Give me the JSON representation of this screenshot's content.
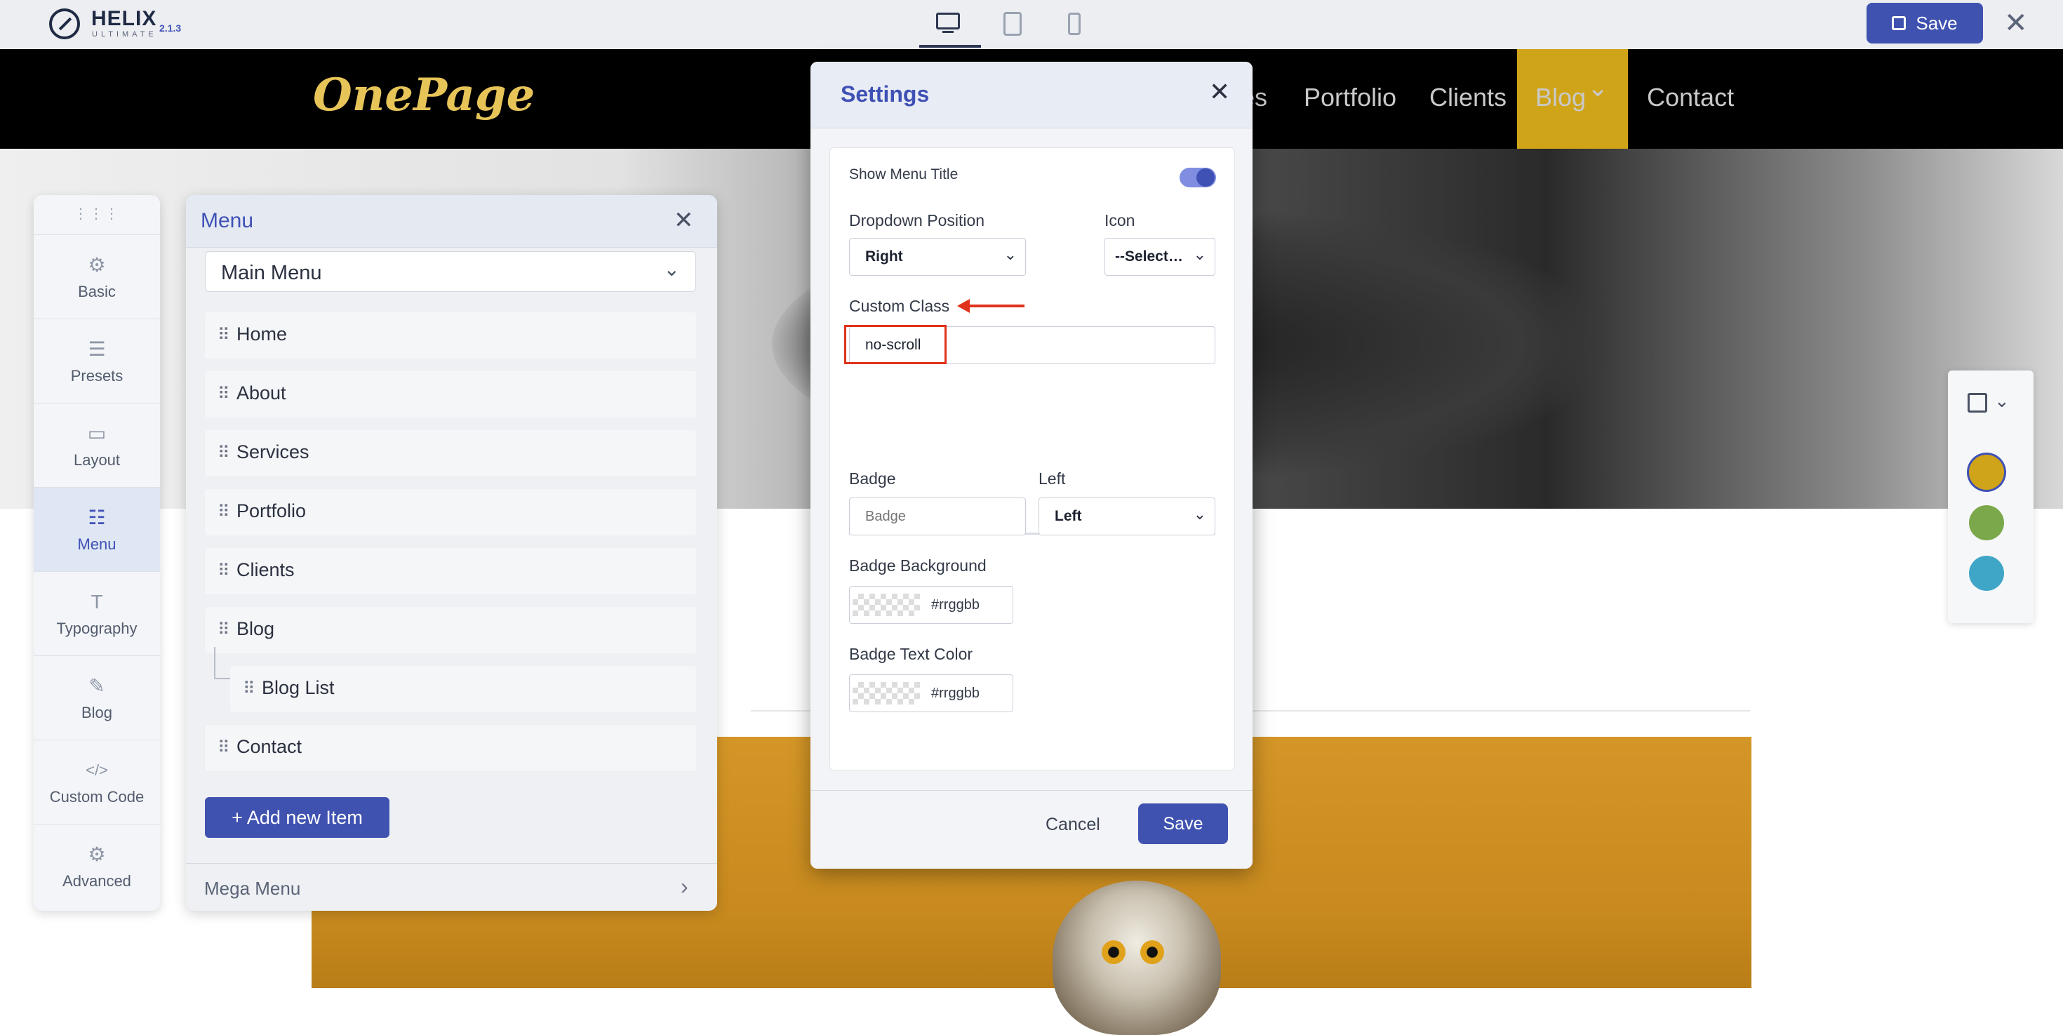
{
  "app": {
    "brand_name": "HELIX",
    "brand_sub": "ULTIMATE",
    "version": "2.1.3",
    "save_label": "Save",
    "close_symbol": "✕"
  },
  "site": {
    "logo_text": "OnePage",
    "nav": [
      "es",
      "Portfolio",
      "Clients",
      "Blog",
      "Contact"
    ],
    "blog_chevron": "⌄"
  },
  "sidebar": {
    "handle": "⋮⋮⋮",
    "items": [
      {
        "label": "Basic",
        "icon": "⚙"
      },
      {
        "label": "Presets",
        "icon": "☰"
      },
      {
        "label": "Layout",
        "icon": "▭"
      },
      {
        "label": "Menu",
        "icon": "☷"
      },
      {
        "label": "Typography",
        "icon": "T"
      },
      {
        "label": "Blog",
        "icon": "✎"
      },
      {
        "label": "Custom Code",
        "icon": "</>"
      },
      {
        "label": "Advanced",
        "icon": "⚙"
      }
    ]
  },
  "menu_panel": {
    "title": "Menu",
    "close": "✕",
    "selected_menu": "Main Menu",
    "chevron": "⌄",
    "grip": "⠿",
    "items": [
      "Home",
      "About",
      "Services",
      "Portfolio",
      "Clients",
      "Blog",
      "Blog List",
      "Contact"
    ],
    "add_label": "+ Add new Item",
    "mega_label": "Mega Menu",
    "mega_arrow": "›"
  },
  "settings": {
    "title": "Settings",
    "close": "✕",
    "show_menu_title_label": "Show Menu Title",
    "show_menu_title_on": true,
    "dropdown_position_label": "Dropdown Position",
    "dropdown_position_value": "Right",
    "icon_label": "Icon",
    "icon_value": "--Select…",
    "custom_class_label": "Custom Class",
    "custom_class_value": "no-scroll",
    "badge_label": "Badge",
    "badge_placeholder": "Badge",
    "badge_position_label": "Left",
    "badge_position_value": "Left",
    "badge_bg_label": "Badge Background",
    "badge_bg_value": "#rrggbb",
    "badge_text_color_label": "Badge Text Color",
    "badge_text_color_value": "#rrggbb",
    "cancel_label": "Cancel",
    "save_label": "Save",
    "chevron": "⌄"
  },
  "presets": {
    "chevron": "⌄",
    "colors": [
      "#d0a419",
      "#7aa84a",
      "#3fa6c8"
    ]
  },
  "colors": {
    "accent": "#4052b0",
    "highlight": "#e0321b"
  }
}
